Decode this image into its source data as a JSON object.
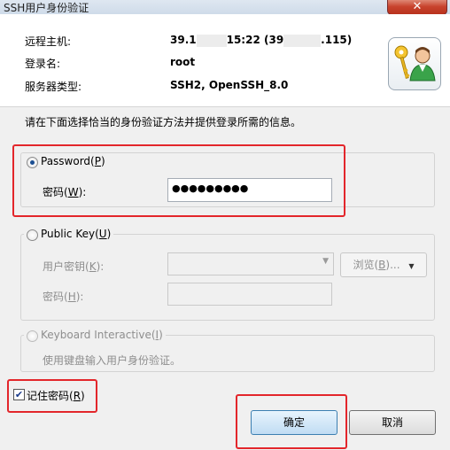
{
  "window": {
    "title": "SSH用户身份验证",
    "close_glyph": "✕"
  },
  "info": {
    "remote_host_label": "远程主机:",
    "remote_host_value_a": "39.1",
    "remote_host_value_b": "15:22 (39",
    "remote_host_value_c": ".115)",
    "login_name_label": "登录名:",
    "login_name_value": "root",
    "server_type_label": "服务器类型:",
    "server_type_value": "SSH2, OpenSSH_8.0"
  },
  "instruction": "请在下面选择恰当的身份验证方法并提供登录所需的信息。",
  "password_group": {
    "label_text": "Password(",
    "label_key": "P",
    "label_end": ")",
    "field_label": "密码(",
    "field_key": "W",
    "field_label_end": "):",
    "value": "●●●●●●●●●",
    "selected": true
  },
  "public_key_group": {
    "label_text": "Public Key(",
    "label_key": "U",
    "label_end": ")",
    "user_key_label": "用户密钥(",
    "user_key_key": "K",
    "user_key_end": "):",
    "browse_label": "浏览(",
    "browse_key": "B",
    "browse_end": ")...",
    "passphrase_label": "密码(",
    "passphrase_key": "H",
    "passphrase_end": "):"
  },
  "keyboard_group": {
    "label_text": "Keyboard Interactive(",
    "label_key": "I",
    "label_end": ")",
    "description": "使用键盘输入用户身份验证。"
  },
  "remember": {
    "label": "记住密码(",
    "key": "R",
    "label_end": ")",
    "checked": true,
    "check_glyph": "✔"
  },
  "buttons": {
    "ok": "确定",
    "cancel": "取消"
  },
  "colors": {
    "highlight_red": "#e3262b",
    "accent_blue": "#3c7fb1"
  },
  "icons": {
    "window_close": "close-icon",
    "user_key": "user-key-icon"
  }
}
